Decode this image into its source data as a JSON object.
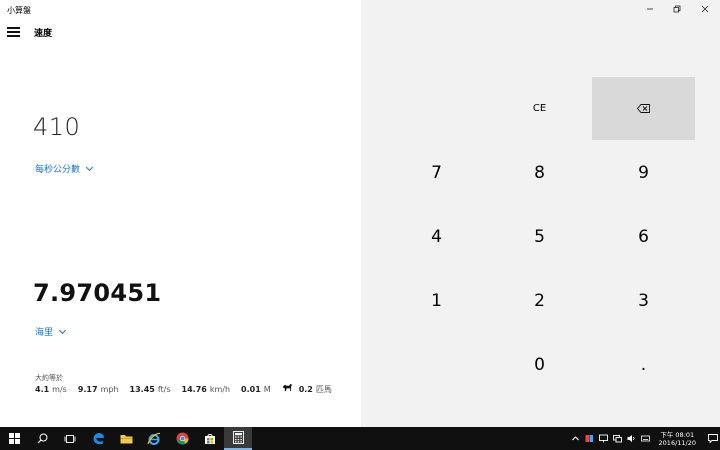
{
  "window": {
    "app_title": "小算盤",
    "mode_title": "速度"
  },
  "converter": {
    "from_value": "410",
    "from_unit": "每秒公分數",
    "to_value": "7.970451",
    "to_unit": "海里"
  },
  "approx": {
    "label": "大約等於",
    "items": [
      {
        "value": "4.1",
        "unit": "m/s"
      },
      {
        "value": "9.17",
        "unit": "mph"
      },
      {
        "value": "13.45",
        "unit": "ft/s"
      },
      {
        "value": "14.76",
        "unit": "km/h"
      },
      {
        "value": "0.01",
        "unit": "M"
      }
    ],
    "horse": {
      "value": "0.2",
      "unit": "匹馬"
    }
  },
  "keypad": {
    "ce": "CE",
    "backspace_icon": "backspace-icon",
    "digits": {
      "7": "7",
      "8": "8",
      "9": "9",
      "4": "4",
      "5": "5",
      "6": "6",
      "1": "1",
      "2": "2",
      "3": "3",
      "0": "0",
      "dot": "."
    }
  },
  "window_controls": [
    "minimize-icon",
    "maximize-icon",
    "close-icon"
  ],
  "taskbar": {
    "apps": [
      "windows-start-icon",
      "search-icon",
      "task-view-icon",
      "edge-icon",
      "file-explorer-icon",
      "internet-explorer-icon",
      "chrome-icon",
      "store-icon",
      "calculator-icon"
    ],
    "time": "下午 08:01",
    "date": "2016/11/20"
  },
  "colors": {
    "accent": "#1a73c8",
    "keypad_bg": "#f2f2f2",
    "backspace_bg": "#d9d9d9",
    "taskbar_bg": "#101010"
  }
}
